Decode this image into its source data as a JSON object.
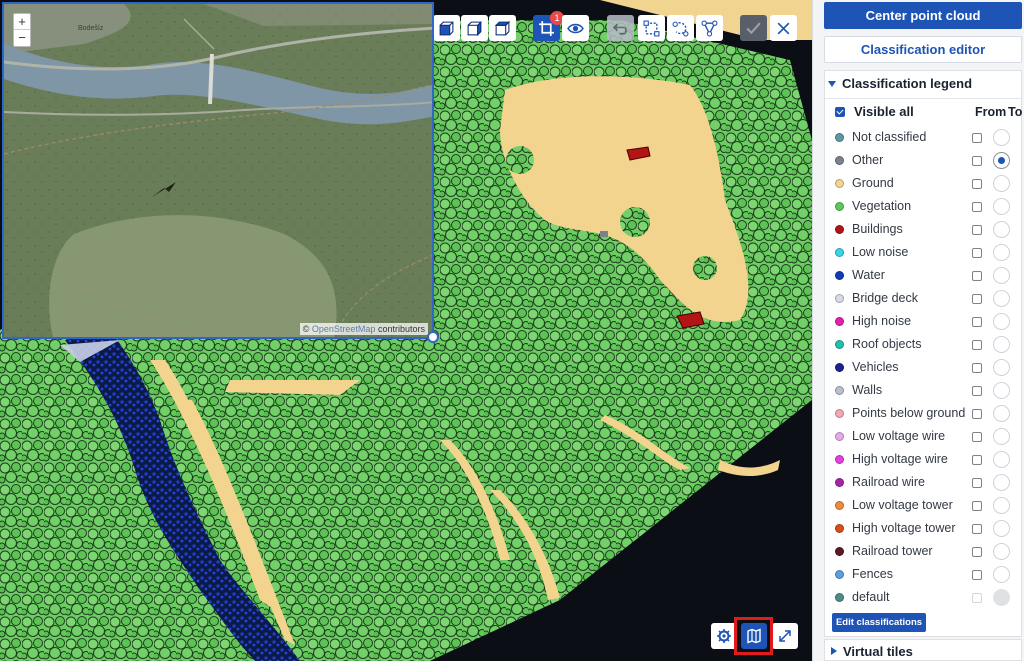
{
  "toolbar": {
    "crop_badge": "1",
    "buttons": [
      "view-front",
      "view-side",
      "view-top",
      "crop",
      "visibility",
      "undo",
      "select-rectangle",
      "select-lasso",
      "select-polygon",
      "confirm",
      "close"
    ]
  },
  "minimap": {
    "zoom_in": "+",
    "zoom_out": "−",
    "attribution_prefix": "©",
    "attribution_link": "OpenStreetMap",
    "attribution_suffix": "contributors",
    "place_label": "Bodešíz"
  },
  "bottom_controls": [
    "settings-icon",
    "map-icon",
    "fullscreen-icon"
  ],
  "panel": {
    "center_button": "Center point cloud",
    "editor_button": "Classification editor",
    "legend_title": "Classification legend",
    "visible_all": "Visible all",
    "col_from": "From",
    "col_to": "To",
    "classes": [
      {
        "label": "Not classified",
        "color": "#5a9aa0",
        "to": false
      },
      {
        "label": "Other",
        "color": "#7a828c",
        "to": true
      },
      {
        "label": "Ground",
        "color": "#f3d58f",
        "to": false
      },
      {
        "label": "Vegetation",
        "color": "#5cc85a",
        "to": false
      },
      {
        "label": "Buildings",
        "color": "#b01616",
        "to": false
      },
      {
        "label": "Low noise",
        "color": "#3ad4e8",
        "to": false
      },
      {
        "label": "Water",
        "color": "#1239b8",
        "to": false
      },
      {
        "label": "Bridge deck",
        "color": "#d7dbe6",
        "to": false
      },
      {
        "label": "High noise",
        "color": "#e41fb0",
        "to": false
      },
      {
        "label": "Roof objects",
        "color": "#23bfae",
        "to": false
      },
      {
        "label": "Vehicles",
        "color": "#1d2290",
        "to": false
      },
      {
        "label": "Walls",
        "color": "#b9bfcc",
        "to": false
      },
      {
        "label": "Points below ground",
        "color": "#f2a8b4",
        "to": false
      },
      {
        "label": "Low voltage wire",
        "color": "#e7a9ec",
        "to": false
      },
      {
        "label": "High voltage wire",
        "color": "#e640e0",
        "to": false
      },
      {
        "label": "Railroad wire",
        "color": "#a724a8",
        "to": false
      },
      {
        "label": "Low voltage tower",
        "color": "#f08a3c",
        "to": false
      },
      {
        "label": "High voltage tower",
        "color": "#d94d17",
        "to": false
      },
      {
        "label": "Railroad tower",
        "color": "#5b1a22",
        "to": false
      },
      {
        "label": "Fences",
        "color": "#5aa0e0",
        "to": false
      },
      {
        "label": "default",
        "color": "#4f8c86",
        "to": false,
        "disabled": true
      }
    ],
    "edit_button": "Edit classifications",
    "virtual_tiles": "Virtual tiles"
  }
}
